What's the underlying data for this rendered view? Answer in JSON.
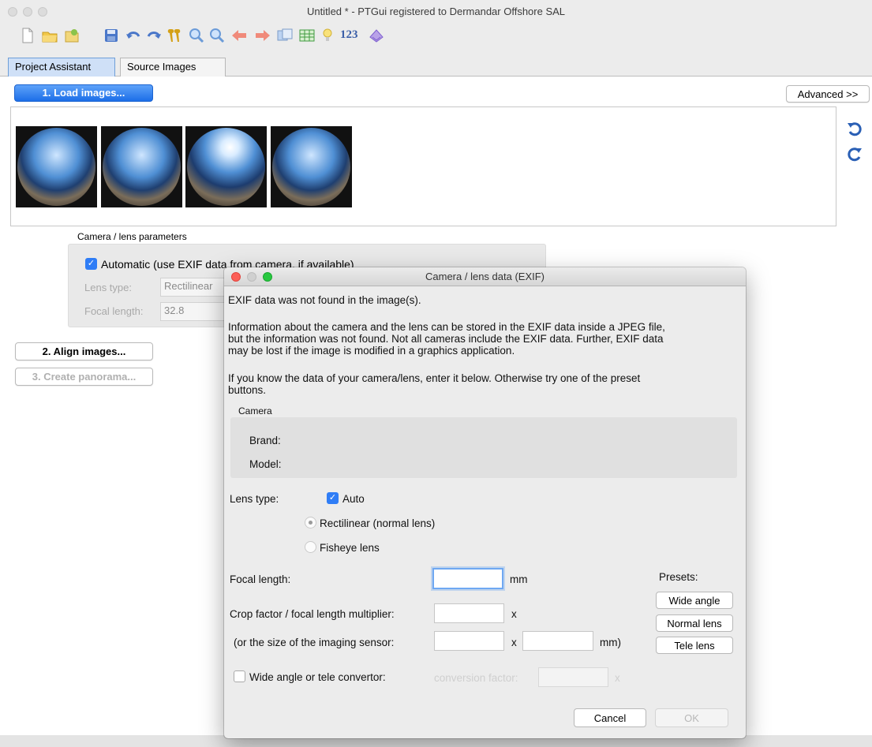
{
  "window": {
    "title": "Untitled * - PTGui registered to Dermandar Offshore SAL",
    "toolbar_text": "123"
  },
  "tabs": [
    "Project Assistant",
    "Source Images"
  ],
  "main": {
    "load_button": "1. Load images...",
    "advanced_button": "Advanced >>",
    "align_button": "2. Align images...",
    "create_button": "3. Create panorama...",
    "camera_group_title": "Camera / lens parameters",
    "automatic_label": "Automatic (use EXIF data from camera, if available)",
    "lens_type_label": "Lens type:",
    "lens_type_value": "Rectilinear",
    "focal_label": "Focal length:",
    "focal_value": "32.8"
  },
  "dialog": {
    "title": "Camera / lens data (EXIF)",
    "msg_not_found": "EXIF data was not found in the image(s).",
    "msg_info_1": "Information about the camera and the lens can be stored in the EXIF data inside a JPEG file,",
    "msg_info_2": "but the information was not found. Not all cameras include the EXIF data. Further, EXIF data",
    "msg_info_3": "may be lost if the image is modified in a graphics application.",
    "msg_know_1": "If you know the data of your camera/lens, enter it below. Otherwise try one of the preset",
    "msg_know_2": "buttons.",
    "camera_title": "Camera",
    "brand_label": "Brand:",
    "model_label": "Model:",
    "lens_type_label": "Lens type:",
    "auto_label": "Auto",
    "rectilinear_label": "Rectilinear (normal lens)",
    "fisheye_label": "Fisheye lens",
    "focal_label": "Focal length:",
    "focal_unit": "mm",
    "crop_label": "Crop factor / focal length multiplier:",
    "crop_x": "x",
    "sensor_label": "(or the size of the imaging sensor:",
    "sensor_x": "x",
    "sensor_unit": "mm)",
    "presets_label": "Presets:",
    "preset_wide": "Wide angle",
    "preset_normal": "Normal lens",
    "preset_tele": "Tele lens",
    "convertor_label": "Wide angle or tele convertor:",
    "conversion_label": "conversion factor:",
    "conversion_x": "x",
    "cancel": "Cancel",
    "ok": "OK"
  },
  "colors": {
    "accent_blue": "#2f7df6",
    "close_red": "#fc5f57",
    "minimize_yellow": "#fdbc2e",
    "zoom_green": "#28c840"
  },
  "icons": [
    "new-file-icon",
    "open-folder-icon",
    "open-template-icon",
    "save-icon",
    "undo-icon",
    "redo-icon",
    "control-points-icon",
    "zoom-in-icon",
    "zoom-out-icon",
    "previous-icon",
    "next-icon",
    "panorama-editor-icon",
    "table-icon",
    "tip-icon",
    "numbers-icon",
    "optimizer-icon",
    "rotate-left-icon",
    "rotate-right-icon"
  ]
}
